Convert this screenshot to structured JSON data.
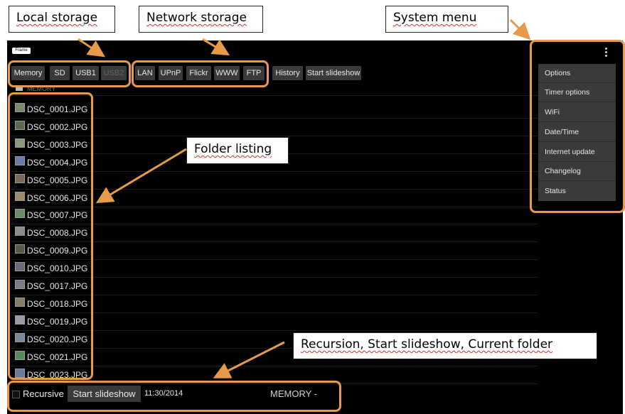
{
  "callouts": {
    "local": "Local storage",
    "network": "Network storage",
    "system": "System menu",
    "folder": "Folder listing",
    "recursion": "Recursion, Start slideshow, Current folder"
  },
  "logo_text": "Frame",
  "local_buttons": [
    "Memory",
    "SD",
    "USB1",
    "USB2"
  ],
  "network_buttons": [
    "LAN",
    "UPnP",
    "Flickr",
    "WWW",
    "FTP"
  ],
  "toolbar": {
    "history": "History",
    "start_slideshow": "Start slideshow"
  },
  "folder_header": "MEMORY",
  "files": [
    "DSC_0001.JPG",
    "DSC_0002.JPG",
    "DSC_0003.JPG",
    "DSC_0004.JPG",
    "DSC_0005.JPG",
    "DSC_0006.JPG",
    "DSC_0007.JPG",
    "DSC_0008.JPG",
    "DSC_0009.JPG",
    "DSC_0010.JPG",
    "DSC_0017.JPG",
    "DSC_0018.JPG",
    "DSC_0019.JPG",
    "DSC_0020.JPG",
    "DSC_0021.JPG",
    "DSC_0023.JPG"
  ],
  "system_menu": [
    "Options",
    "Timer options",
    "WiFi",
    "Date/Time",
    "Internet update",
    "Changelog",
    "Status"
  ],
  "bottom": {
    "recursive_label": "Recursive",
    "start_slideshow": "Start slideshow",
    "time": "11:30/2014",
    "current_folder": "MEMORY -"
  },
  "colors": {
    "accent": "#e69a4a",
    "screen": "#000000",
    "button": "#3a3a3a"
  }
}
